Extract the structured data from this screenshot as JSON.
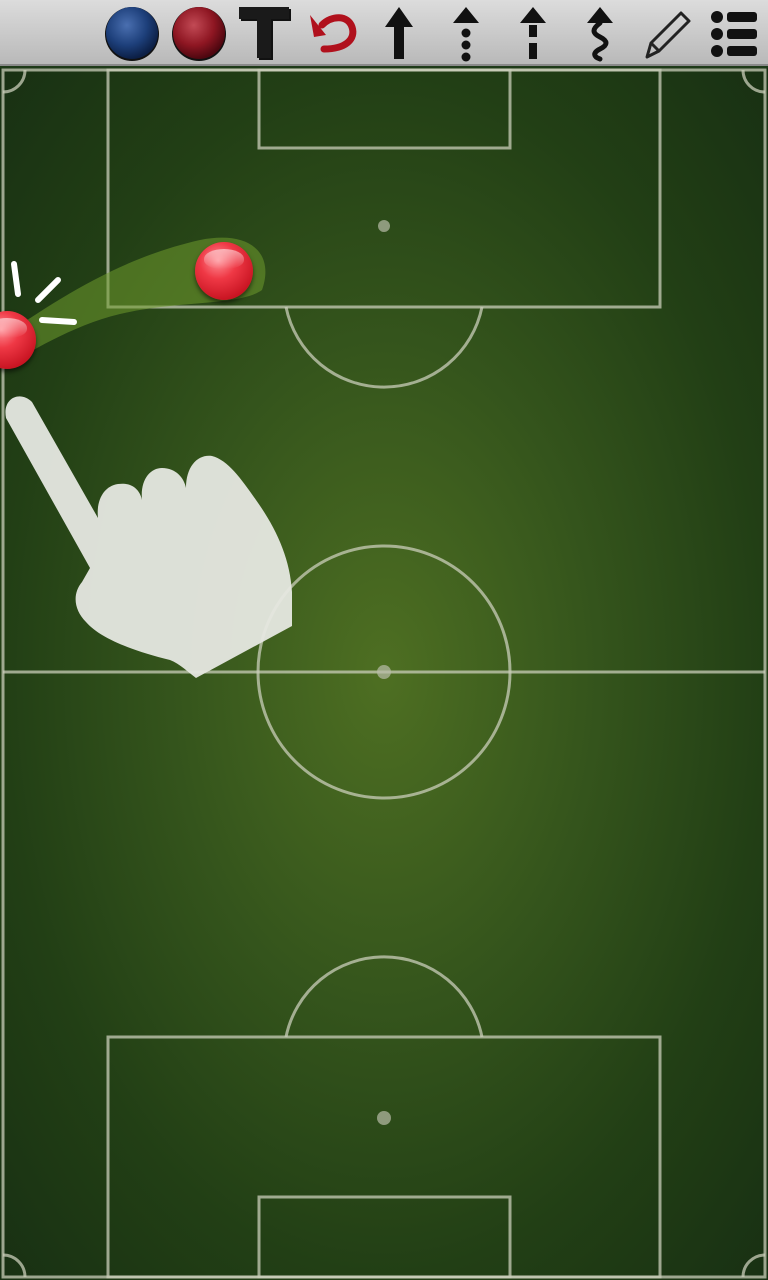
{
  "toolbar": {
    "tools": [
      {
        "name": "blue-token-tool",
        "icon": "blue-circle-icon",
        "color": "#1d3f7a"
      },
      {
        "name": "red-token-tool",
        "icon": "red-circle-icon",
        "color": "#8e1622"
      },
      {
        "name": "text-tool",
        "icon": "letter-t-icon"
      },
      {
        "name": "undo-tool",
        "icon": "undo-arrow-icon",
        "color": "#b0101c"
      },
      {
        "name": "solid-arrow-tool",
        "icon": "solid-arrow-up-icon"
      },
      {
        "name": "dotted-arrow-tool",
        "icon": "dotted-arrow-up-icon"
      },
      {
        "name": "dashed-arrow-tool",
        "icon": "dashed-arrow-up-icon"
      },
      {
        "name": "wavy-arrow-tool",
        "icon": "wavy-arrow-up-icon"
      },
      {
        "name": "pencil-tool",
        "icon": "pencil-icon"
      },
      {
        "name": "menu-tool",
        "icon": "list-menu-icon"
      }
    ]
  },
  "pitch": {
    "surface": "grass",
    "line_color": "#c9cdb9",
    "tokens": [
      {
        "name": "red-player-token-1",
        "color": "#e8303d"
      },
      {
        "name": "red-player-token-2",
        "color": "#e8303d"
      }
    ],
    "overlay": {
      "name": "tap-hand-icon",
      "hint": "drag gesture"
    }
  }
}
